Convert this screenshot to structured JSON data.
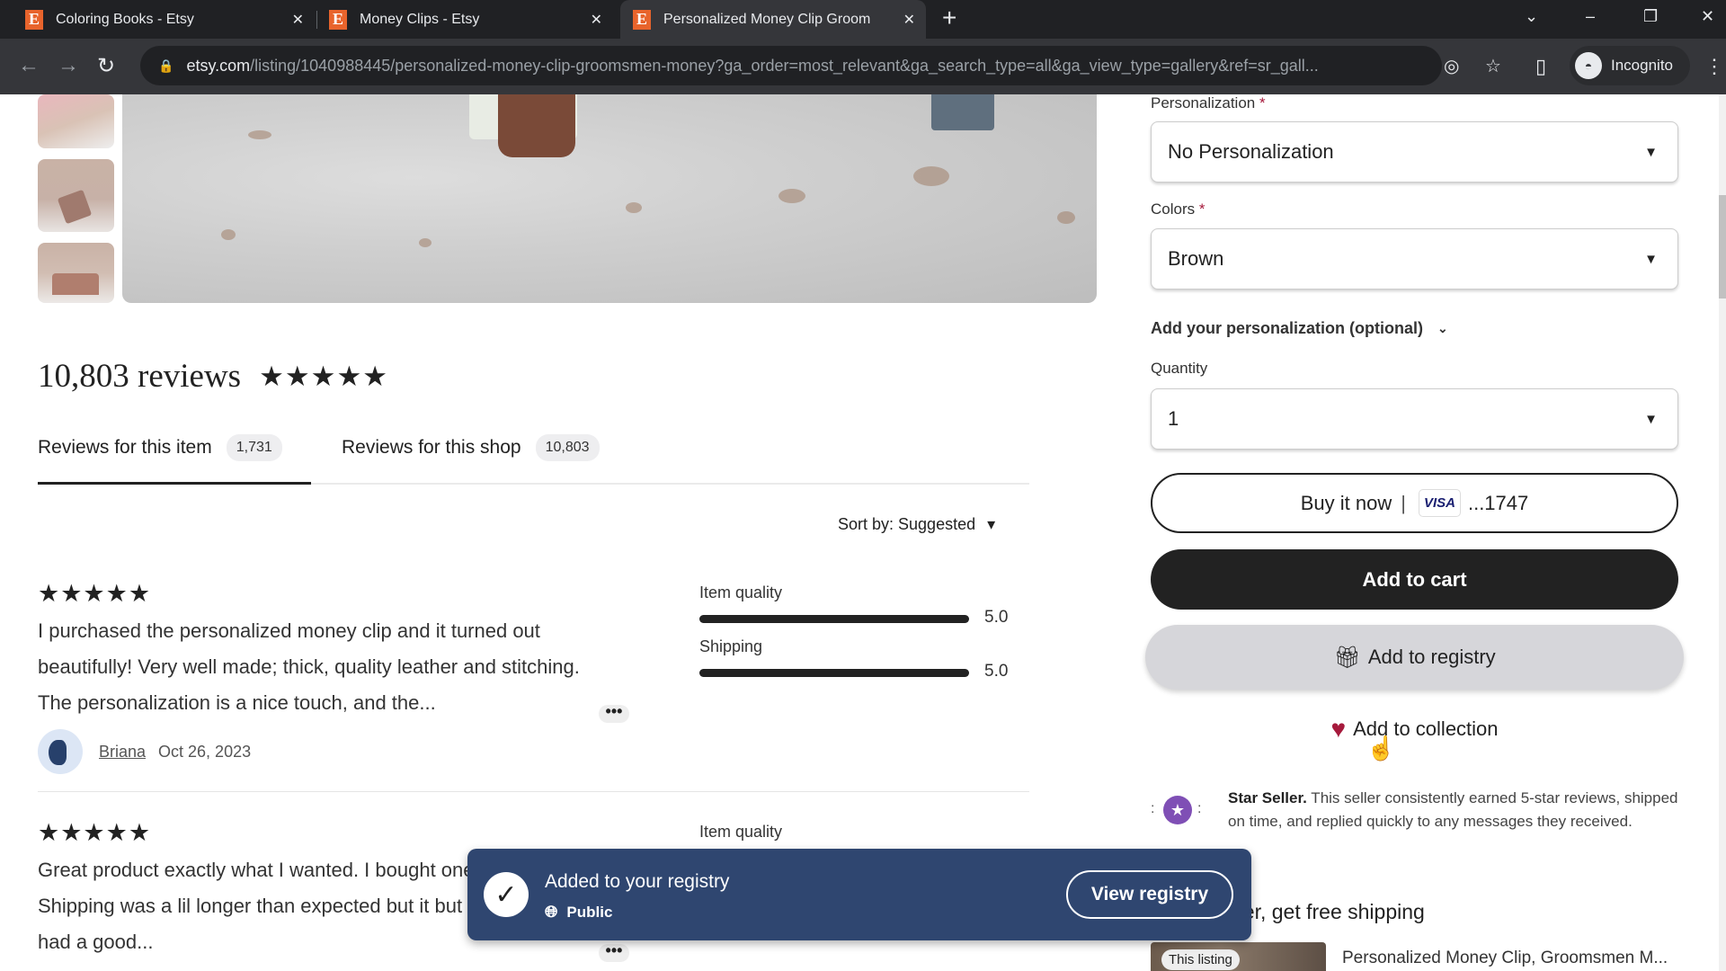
{
  "browser": {
    "tabs": [
      {
        "title": "Coloring Books - Etsy",
        "favicon": "E"
      },
      {
        "title": "Money Clips - Etsy",
        "favicon": "E"
      },
      {
        "title": "Personalized Money Clip Groom",
        "favicon": "E",
        "active": true
      }
    ],
    "new_tab": "+",
    "url_domain": "etsy.com",
    "url_path": "/listing/1040988445/personalized-money-clip-groomsmen-money?ga_order=most_relevant&ga_search_type=all&ga_view_type=gallery&ref=sr_gall...",
    "profile_label": "Incognito",
    "icons": {
      "back": "←",
      "forward": "→",
      "reload": "↻",
      "lock": "🔒",
      "eye_off": "◎",
      "star": "☆",
      "sidepanel": "▯",
      "menu": "⋮",
      "tab_search": "⌄",
      "minimize": "–",
      "restore": "❐",
      "close": "✕"
    }
  },
  "reviews": {
    "title": "10,803 reviews",
    "stars": "★★★★★",
    "tabs": [
      {
        "label": "Reviews for this item",
        "count": "1,731",
        "active": true
      },
      {
        "label": "Reviews for this shop",
        "count": "10,803"
      }
    ],
    "sort_label": "Sort by: Suggested",
    "sort_caret": "▾",
    "items": [
      {
        "stars": "★★★★★",
        "text": "I purchased the personalized money clip and it turned out beautifully! Very well made; thick, quality leather and stitching. The personalization is a nice touch, and the...",
        "author": "Briana",
        "date": "Oct 26, 2023",
        "metrics": [
          {
            "label": "Item quality",
            "score": "5.0",
            "value": 5.0,
            "max": 5
          },
          {
            "label": "Shipping",
            "score": "5.0",
            "value": 5.0,
            "max": 5
          }
        ],
        "more": "•••"
      },
      {
        "stars": "★★★★★",
        "text": "Great product exactly what I wanted. I bought one with my initials. Shipping was a lil longer than expected but it but other than that I had a good...",
        "metrics": [
          {
            "label": "Item quality"
          }
        ],
        "more": "•••"
      }
    ]
  },
  "purchase": {
    "personalization": {
      "label": "Personalization",
      "required": "*",
      "value": "No Personalization"
    },
    "colors": {
      "label": "Colors",
      "required": "*",
      "value": "Brown"
    },
    "optional_toggle": "Add your personalization (optional)",
    "quantity": {
      "label": "Quantity",
      "value": "1"
    },
    "caret": "▼",
    "buy_now": {
      "label": "Buy it now",
      "separator": "|",
      "card_brand": "VISA",
      "card_last4": "...1747"
    },
    "add_to_cart": "Add to cart",
    "add_to_registry": "Add to registry",
    "add_to_collection": "Add to collection",
    "star_seller": {
      "title": "Star Seller.",
      "text": " This seller consistently earned 5-star reviews, shipped on time, and replied quickly to any messages they received."
    },
    "free_shipping": "her, get free shipping",
    "listing": {
      "badge": "This listing",
      "title": "Personalized Money Clip, Groomsmen M..."
    }
  },
  "toast": {
    "message": "Added to your registry",
    "visibility": "Public",
    "action": "View registry"
  },
  "colors": {
    "etsy_orange": "#e8642c",
    "toast_bg": "#2f4670",
    "required_star": "#a61a3c",
    "heart": "#a61a3c",
    "star_seller": "#7f4fb5",
    "cart_button": "#222222"
  }
}
